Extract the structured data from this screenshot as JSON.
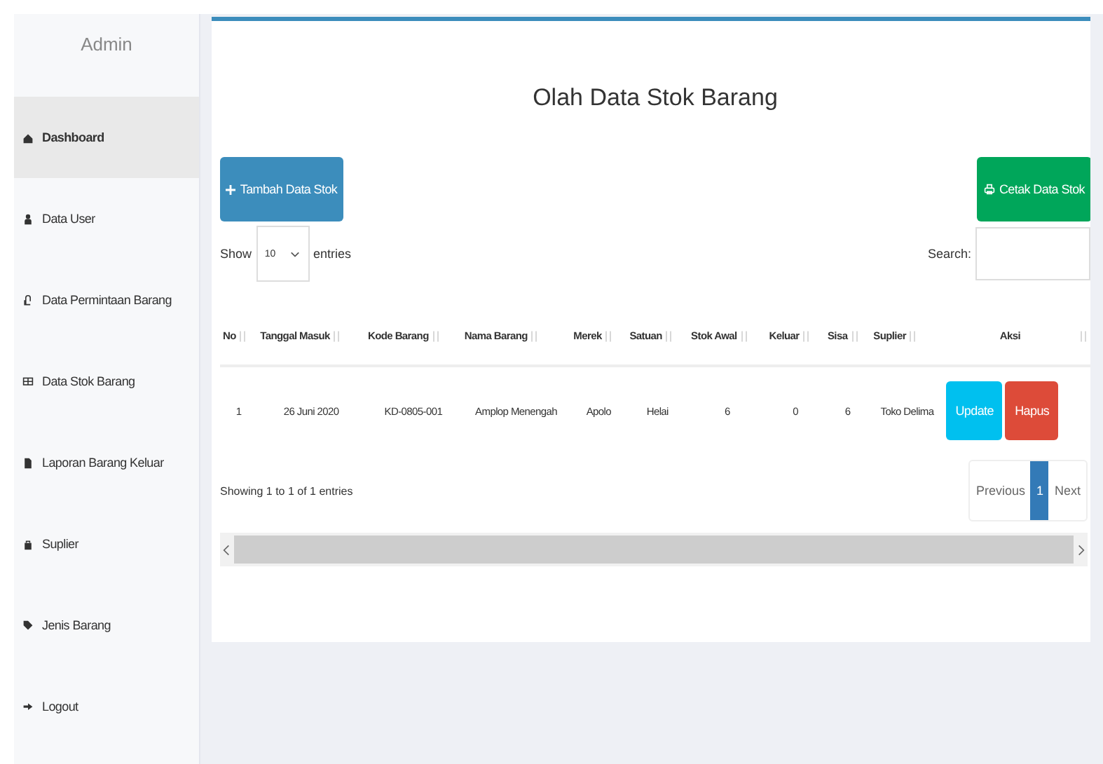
{
  "sidebar": {
    "title": "Admin",
    "items": [
      {
        "label": "Dashboard",
        "selected": true
      },
      {
        "label": "Data User",
        "selected": false
      },
      {
        "label": "Data Permintaan Barang",
        "selected": false
      },
      {
        "label": "Data Stok Barang",
        "selected": false
      },
      {
        "label": "Laporan Barang Keluar",
        "selected": false
      },
      {
        "label": "Suplier",
        "selected": false
      },
      {
        "label": "Jenis Barang",
        "selected": false
      },
      {
        "label": "Logout",
        "selected": false
      }
    ]
  },
  "page": {
    "title": "Olah Data Stok Barang",
    "add_button": "Tambah Data Stok",
    "print_button": "Cetak Data Stok",
    "show_label": "Show",
    "page_size": "10",
    "entries_label": "entries",
    "search_label": "Search:",
    "table": {
      "columns": [
        "No",
        "Tanggal Masuk",
        "Kode Barang",
        "Nama Barang",
        "Merek",
        "Satuan",
        "Stok Awal",
        "Keluar",
        "Sisa",
        "Suplier",
        "Aksi"
      ],
      "rows": [
        {
          "cells": [
            "1",
            "26 Juni 2020",
            "KD-0805-001",
            "Amplop Menengah",
            "Apolo",
            "Helai",
            "6",
            "0",
            "6",
            "Toko Delima"
          ],
          "actions": [
            {
              "label": "Update",
              "kind": "update"
            },
            {
              "label": "Hapus",
              "kind": "delete"
            }
          ]
        }
      ]
    },
    "info": "Showing 1 to 1 of 1 entries",
    "pagination": [
      {
        "label": "Previous",
        "selected": false
      },
      {
        "label": "1",
        "selected": true
      },
      {
        "label": "Next",
        "selected": false
      }
    ]
  }
}
